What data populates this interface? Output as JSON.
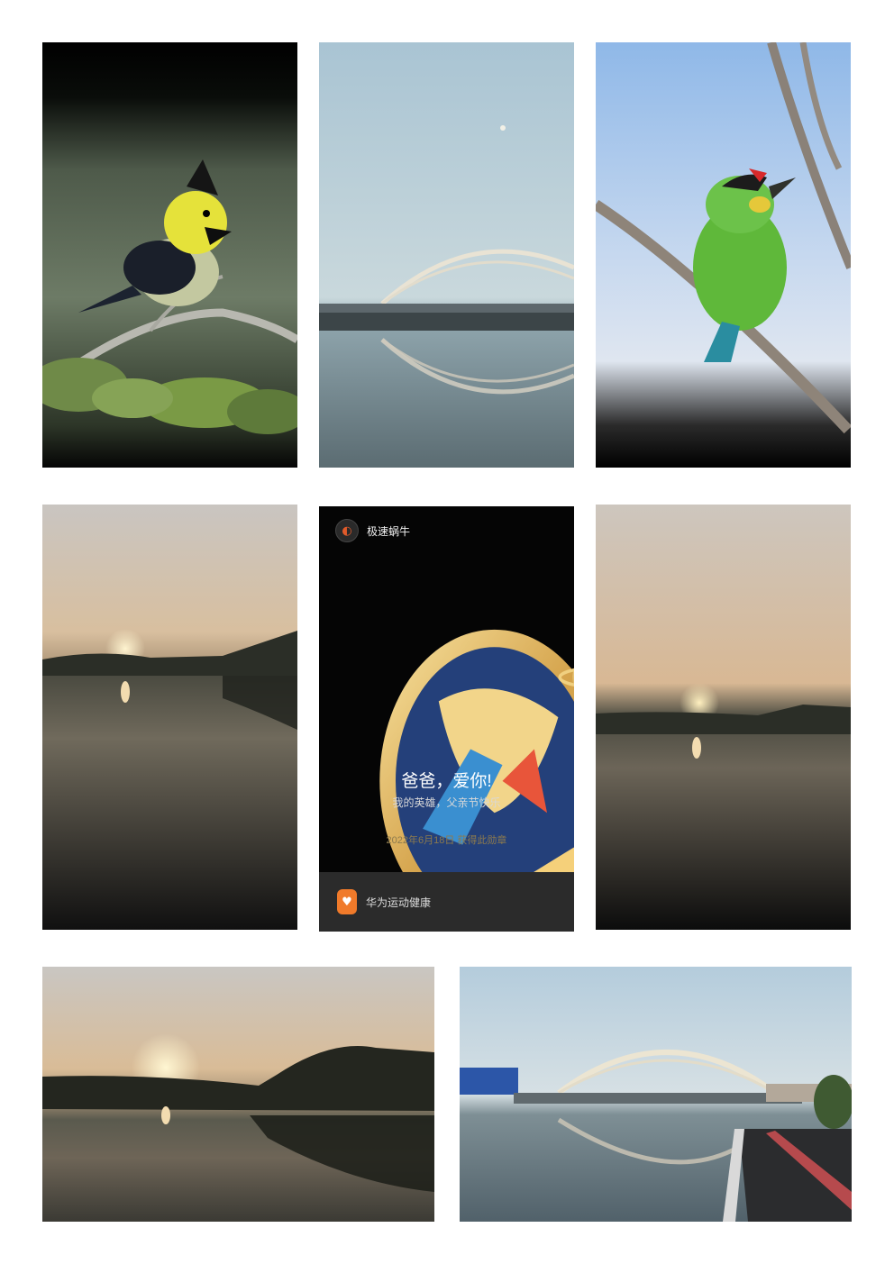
{
  "card": {
    "app_name": "极速蜗牛",
    "title": "爸爸，爱你!",
    "subtitle": "我的英雄，父亲节快乐",
    "date_text": "2022年6月18日 获得此勋章",
    "footer_app": "华为运动健康"
  },
  "photos": [
    {
      "subject": "yellow-cheeked tit on branch"
    },
    {
      "subject": "arch bridge with reflection"
    },
    {
      "subject": "green barbet on branch"
    },
    {
      "subject": "sunset over river"
    },
    {
      "subject": "fathers day medal card"
    },
    {
      "subject": "sunset over river"
    },
    {
      "subject": "sunset over river wide"
    },
    {
      "subject": "arch bridge with road"
    }
  ]
}
